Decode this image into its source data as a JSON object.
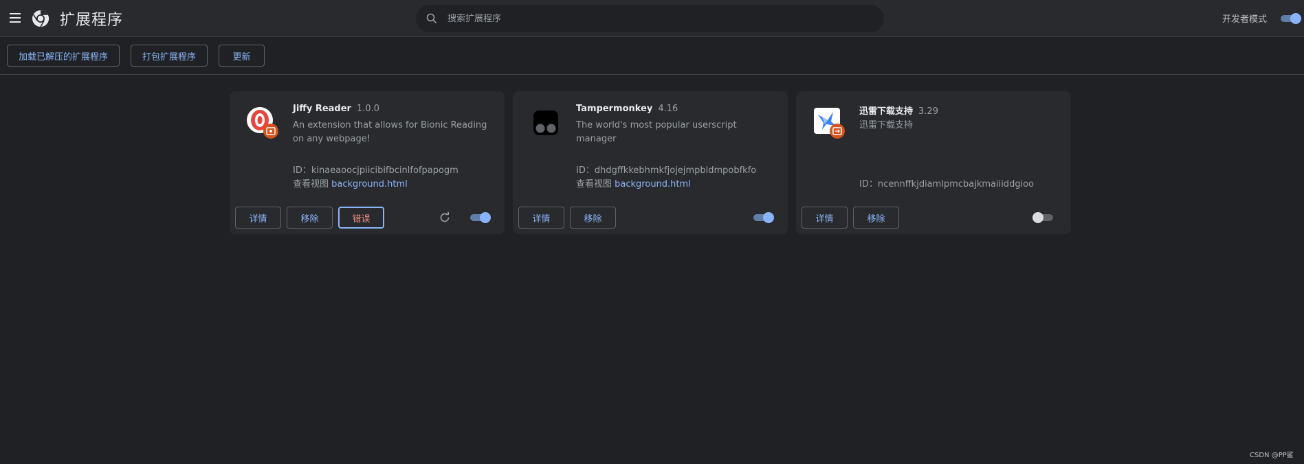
{
  "header": {
    "title": "扩展程序",
    "search_placeholder": "搜索扩展程序",
    "dev_mode_label": "开发者模式",
    "dev_mode_on": true
  },
  "toolbar": {
    "load_unpacked": "加载已解压的扩展程序",
    "pack_extension": "打包扩展程序",
    "update": "更新"
  },
  "extensions": [
    {
      "name": "Jiffy Reader",
      "version": "1.0.0",
      "description": "An extension that allows for Bionic Reading on any webpage!",
      "id_label": "ID：",
      "id": "kinaeaoocjpiicibifbcinlfofpapogm",
      "view_label": "查看视图",
      "view_link": "background.html",
      "details": "详情",
      "remove": "移除",
      "errors": "错误",
      "enabled": true
    },
    {
      "name": "Tampermonkey",
      "version": "4.16",
      "description": "The world's most popular userscript manager",
      "id_label": "ID：",
      "id": "dhdgffkkebhmkfjojejmpbldmpobfkfo",
      "view_label": "查看视图",
      "view_link": "background.html",
      "details": "详情",
      "remove": "移除",
      "enabled": true
    },
    {
      "name": "迅雷下载支持",
      "version": "3.29",
      "description": "迅雷下载支持",
      "id_label": "ID：",
      "id": "ncennffkjdiamlpmcbajkmaiiiddgioo",
      "details": "详情",
      "remove": "移除",
      "enabled": false
    }
  ],
  "footer": {
    "watermark": "CSDN @PP鲨"
  },
  "colors": {
    "background": "#202124",
    "card": "#292a2d",
    "accent": "#8ab4f8",
    "error": "#f28b82"
  }
}
